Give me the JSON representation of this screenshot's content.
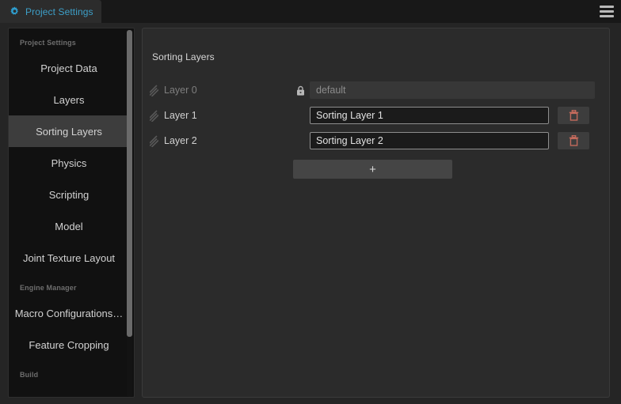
{
  "window": {
    "tab": {
      "label": "Project Settings",
      "icon": "gear-icon",
      "accent_color": "#3d9fc8"
    },
    "menu_button": {
      "icon": "hamburger-icon"
    }
  },
  "sidebar": {
    "groups": [
      {
        "section": "Project Settings",
        "items": [
          {
            "label": "Project Data",
            "selected": false
          },
          {
            "label": "Layers",
            "selected": false
          },
          {
            "label": "Sorting Layers",
            "selected": true
          },
          {
            "label": "Physics",
            "selected": false
          },
          {
            "label": "Scripting",
            "selected": false
          },
          {
            "label": "Model",
            "selected": false
          },
          {
            "label": "Joint Texture Layout",
            "selected": false
          }
        ]
      },
      {
        "section": "Engine Manager",
        "items": [
          {
            "label": "Macro Configurations…",
            "selected": false
          },
          {
            "label": "Feature Cropping",
            "selected": false
          }
        ]
      },
      {
        "section": "Build",
        "items": []
      }
    ]
  },
  "main": {
    "title": "Sorting Layers",
    "rows": [
      {
        "label": "Layer 0",
        "value": "default",
        "locked": true,
        "deletable": false,
        "handle_icon": "drag-handle-icon",
        "lock_icon": "lock-icon"
      },
      {
        "label": "Layer 1",
        "value": "Sorting Layer 1",
        "locked": false,
        "deletable": true,
        "handle_icon": "drag-handle-icon",
        "delete_icon": "trash-icon"
      },
      {
        "label": "Layer 2",
        "value": "Sorting Layer 2",
        "locked": false,
        "deletable": true,
        "handle_icon": "drag-handle-icon",
        "delete_icon": "trash-icon"
      }
    ],
    "add_button": {
      "label": "+",
      "icon": "plus-icon"
    },
    "colors": {
      "delete_icon": "#c26a5c",
      "panel_bg": "#2b2b2b",
      "input_bg": "#1b1b1b"
    }
  }
}
